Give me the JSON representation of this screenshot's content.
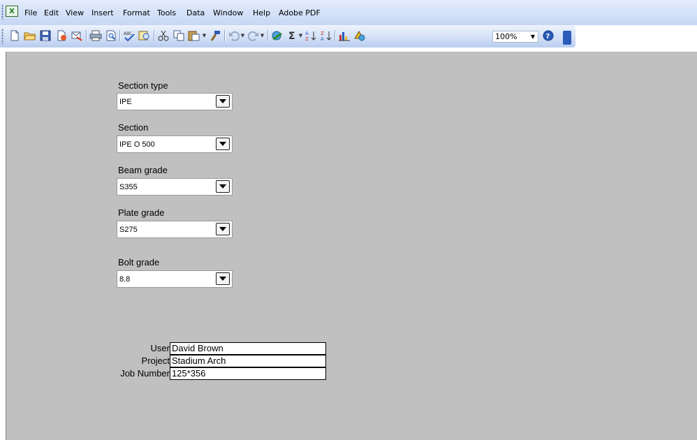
{
  "menu": {
    "items": [
      "File",
      "Edit",
      "View",
      "Insert",
      "Format",
      "Tools",
      "Data",
      "Window",
      "Help",
      "Adobe PDF"
    ]
  },
  "toolbar": {
    "icons": [
      "new-icon",
      "open-icon",
      "save-icon",
      "permission-icon",
      "print-icon",
      "print-preview-icon",
      "spelling-icon",
      "research-icon",
      "cut-icon",
      "copy-icon",
      "paste-icon",
      "format-painter-icon",
      "undo-icon",
      "redo-icon",
      "hyperlink-icon",
      "autosum-icon",
      "sort-ascending-icon",
      "sort-descending-icon",
      "chart-wizard-icon",
      "drawing-icon",
      "help-icon"
    ],
    "zoom": "100%"
  },
  "form": {
    "section_type": {
      "label": "Section type",
      "value": "IPE"
    },
    "section": {
      "label": "Section",
      "value": "IPE O 500"
    },
    "beam_grade": {
      "label": "Beam grade",
      "value": "S355"
    },
    "plate_grade": {
      "label": "Plate grade",
      "value": "S275"
    },
    "bolt_grade": {
      "label": "Bolt grade",
      "value": "8.8"
    }
  },
  "info": {
    "user": {
      "label": "User",
      "value": "David Brown"
    },
    "project": {
      "label": "Project",
      "value": "Stadium Arch"
    },
    "job_number": {
      "label": "Job Number",
      "value": "125*356"
    }
  },
  "colors": {
    "toolbar_bg": "#c6d7f5",
    "sheet_bg": "#c0c0c0"
  }
}
